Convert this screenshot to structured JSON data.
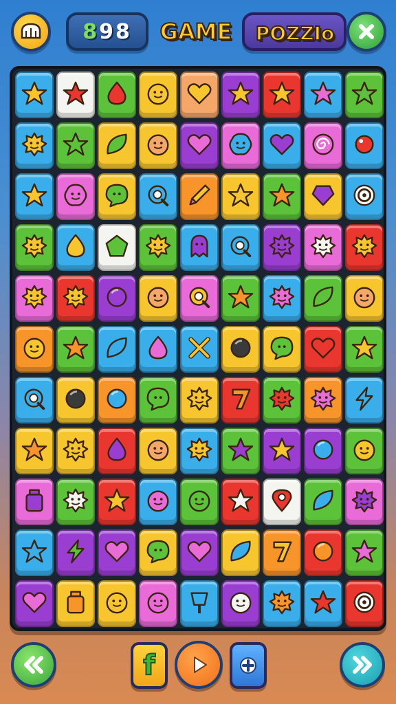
{
  "header": {
    "score": "898",
    "title_left": "GAME",
    "title_right": "POZZIo",
    "home_icon": "crown-icon",
    "close_icon": "close-icon"
  },
  "colors": {
    "yellow": "#f7c62f",
    "orange": "#f7942a",
    "red": "#e9372f",
    "green": "#5cc23a",
    "blue": "#3aaeea",
    "purple": "#9a3ed1",
    "pink": "#e86bd8",
    "white": "#f4f4f0",
    "peach": "#f4a768"
  },
  "board": {
    "rows": [
      [
        [
          "blue",
          "star",
          "yellow"
        ],
        [
          "white",
          "star",
          "red"
        ],
        [
          "green",
          "drop",
          "red"
        ],
        [
          "yellow",
          "face",
          "yellow"
        ],
        [
          "peach",
          "heart",
          "yellow"
        ],
        [
          "purple",
          "star",
          "yellow"
        ],
        [
          "red",
          "star",
          "yellow"
        ],
        [
          "blue",
          "star",
          "pink"
        ],
        [
          "green",
          "star",
          "green"
        ]
      ],
      [
        [
          "blue",
          "sun",
          "yellow"
        ],
        [
          "green",
          "star",
          "green"
        ],
        [
          "yellow",
          "leaf",
          "green"
        ],
        [
          "yellow",
          "face",
          "peach"
        ],
        [
          "purple",
          "heart",
          "pink"
        ],
        [
          "pink",
          "blob",
          "blue"
        ],
        [
          "blue",
          "heart",
          "purple"
        ],
        [
          "pink",
          "swirl",
          "pink"
        ],
        [
          "blue",
          "dot",
          "red"
        ]
      ],
      [
        [
          "blue",
          "star",
          "yellow"
        ],
        [
          "pink",
          "blob",
          "pink"
        ],
        [
          "yellow",
          "bubble",
          "green"
        ],
        [
          "blue",
          "q",
          "blue"
        ],
        [
          "orange",
          "pencil",
          "yellow"
        ],
        [
          "yellow",
          "star",
          "yellow"
        ],
        [
          "green",
          "star",
          "orange"
        ],
        [
          "yellow",
          "gem",
          "purple"
        ],
        [
          "blue",
          "target",
          "white"
        ]
      ],
      [
        [
          "green",
          "sun",
          "yellow"
        ],
        [
          "blue",
          "drop",
          "yellow"
        ],
        [
          "white",
          "pentagon",
          "green"
        ],
        [
          "green",
          "sun",
          "yellow"
        ],
        [
          "blue",
          "ghost",
          "purple"
        ],
        [
          "blue",
          "q",
          "blue"
        ],
        [
          "purple",
          "sun",
          "purple"
        ],
        [
          "pink",
          "sun",
          "white"
        ],
        [
          "red",
          "sun",
          "yellow"
        ]
      ],
      [
        [
          "pink",
          "sun",
          "yellow"
        ],
        [
          "red",
          "sun",
          "yellow"
        ],
        [
          "purple",
          "circle",
          "purple"
        ],
        [
          "yellow",
          "face",
          "peach"
        ],
        [
          "pink",
          "q",
          "yellow"
        ],
        [
          "green",
          "star",
          "orange"
        ],
        [
          "blue",
          "sun",
          "pink"
        ],
        [
          "green",
          "leaf",
          "green"
        ],
        [
          "yellow",
          "face",
          "peach"
        ]
      ],
      [
        [
          "orange",
          "face",
          "yellow"
        ],
        [
          "green",
          "star",
          "orange"
        ],
        [
          "blue",
          "leaf",
          "blue"
        ],
        [
          "blue",
          "drop",
          "pink"
        ],
        [
          "blue",
          "cross",
          "yellow"
        ],
        [
          "yellow",
          "circle",
          "black"
        ],
        [
          "yellow",
          "bubble",
          "green"
        ],
        [
          "red",
          "heart",
          "red"
        ],
        [
          "green",
          "star",
          "yellow"
        ]
      ],
      [
        [
          "blue",
          "q",
          "blue"
        ],
        [
          "yellow",
          "circle",
          "black"
        ],
        [
          "orange",
          "circle",
          "blue"
        ],
        [
          "green",
          "bubble",
          "green"
        ],
        [
          "yellow",
          "sun",
          "yellow"
        ],
        [
          "red",
          "seven",
          "orange"
        ],
        [
          "green",
          "sun",
          "red"
        ],
        [
          "orange",
          "sun",
          "pink"
        ],
        [
          "blue",
          "bolt",
          "blue"
        ]
      ],
      [
        [
          "yellow",
          "star",
          "orange"
        ],
        [
          "yellow",
          "sun",
          "yellow"
        ],
        [
          "red",
          "drop",
          "purple"
        ],
        [
          "yellow",
          "face",
          "peach"
        ],
        [
          "blue",
          "sun",
          "yellow"
        ],
        [
          "green",
          "star",
          "purple"
        ],
        [
          "purple",
          "star",
          "yellow"
        ],
        [
          "purple",
          "circle",
          "blue"
        ],
        [
          "green",
          "face",
          "yellow"
        ]
      ],
      [
        [
          "pink",
          "jar",
          "purple"
        ],
        [
          "green",
          "sun",
          "white"
        ],
        [
          "red",
          "star",
          "yellow"
        ],
        [
          "blue",
          "face",
          "pink"
        ],
        [
          "green",
          "face",
          "green"
        ],
        [
          "red",
          "star",
          "white"
        ],
        [
          "white",
          "pin",
          "red"
        ],
        [
          "green",
          "leaf",
          "blue"
        ],
        [
          "pink",
          "sun",
          "purple"
        ]
      ],
      [
        [
          "blue",
          "star",
          "blue"
        ],
        [
          "purple",
          "bolt",
          "green"
        ],
        [
          "purple",
          "heart",
          "pink"
        ],
        [
          "yellow",
          "bubble",
          "green"
        ],
        [
          "purple",
          "heart",
          "pink"
        ],
        [
          "yellow",
          "leaf",
          "blue"
        ],
        [
          "orange",
          "seven",
          "yellow"
        ],
        [
          "red",
          "circle",
          "orange"
        ],
        [
          "green",
          "star",
          "pink"
        ]
      ],
      [
        [
          "purple",
          "heart",
          "pink"
        ],
        [
          "yellow",
          "jar",
          "orange"
        ],
        [
          "yellow",
          "face",
          "yellow"
        ],
        [
          "pink",
          "face",
          "pink"
        ],
        [
          "blue",
          "sign",
          "blue"
        ],
        [
          "purple",
          "face",
          "white"
        ],
        [
          "blue",
          "sun",
          "orange"
        ],
        [
          "blue",
          "star",
          "red"
        ],
        [
          "red",
          "target",
          "white"
        ]
      ]
    ]
  },
  "footer": {
    "prev_icon": "double-chevron-left-icon",
    "f_label": "f",
    "play_icon": "play-icon",
    "plus_icon": "plus-icon",
    "next_icon": "double-chevron-right-icon"
  }
}
